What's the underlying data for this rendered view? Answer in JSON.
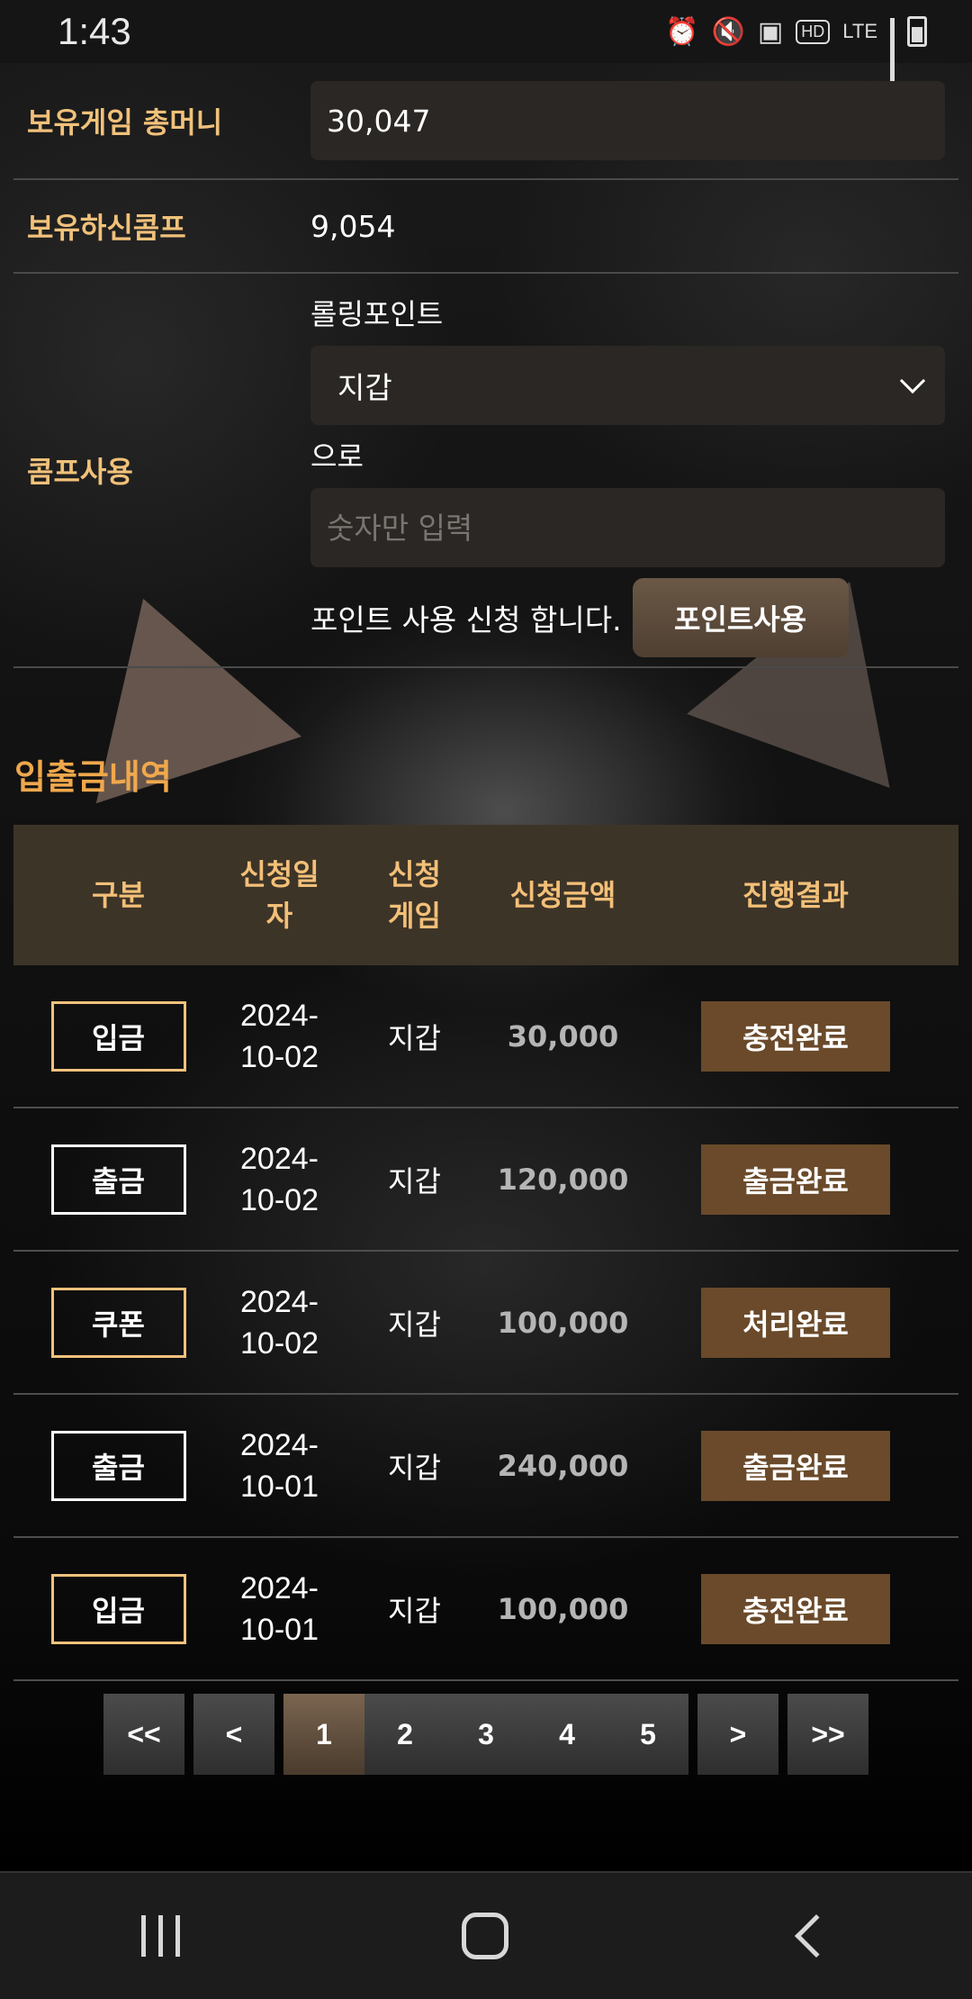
{
  "status_bar": {
    "time": "1:43",
    "icons": [
      "alarm-icon",
      "mute-vibrate-icon",
      "battery-saver-icon",
      "hd-icon",
      "lte-icon",
      "signal-icon",
      "battery-charging-icon"
    ],
    "hd_text": "HD",
    "lte_text": "LTE"
  },
  "balance": {
    "label": "보유게임 총머니",
    "value": "30,047"
  },
  "comp": {
    "label": "보유하신콤프",
    "value": "9,054"
  },
  "comp_use": {
    "label": "콤프사용",
    "rolling_label": "롤링포인트",
    "wallet_selected": "지갑",
    "suffix_label": "으로",
    "amount_placeholder": "숫자만 입력",
    "apply_text": "포인트 사용 신청 합니다.",
    "button_label": "포인트사용"
  },
  "history": {
    "title": "입출금내역",
    "headers": {
      "type": "구분",
      "date": "신청일자",
      "game": "신청게임",
      "amount": "신청금액",
      "result": "진행결과"
    },
    "rows": [
      {
        "type": "입금",
        "date_y": "2024-",
        "date_md": "10-02",
        "game": "지갑",
        "amount": "30,000",
        "result": "충전완료"
      },
      {
        "type": "출금",
        "date_y": "2024-",
        "date_md": "10-02",
        "game": "지갑",
        "amount": "120,000",
        "result": "출금완료"
      },
      {
        "type": "쿠폰",
        "date_y": "2024-",
        "date_md": "10-02",
        "game": "지갑",
        "amount": "100,000",
        "result": "처리완료"
      },
      {
        "type": "출금",
        "date_y": "2024-",
        "date_md": "10-01",
        "game": "지갑",
        "amount": "240,000",
        "result": "출금완료"
      },
      {
        "type": "입금",
        "date_y": "2024-",
        "date_md": "10-01",
        "game": "지갑",
        "amount": "100,000",
        "result": "충전완료"
      }
    ]
  },
  "pagination": {
    "first": "<<",
    "prev": "<",
    "pages": [
      "1",
      "2",
      "3",
      "4",
      "5"
    ],
    "current": "1",
    "next": ">",
    "last": ">>"
  },
  "colors": {
    "accent_gold": "#f1c17a",
    "title_orange": "#f0a84c",
    "header_bg": "#3d3428",
    "result_bg": "#6a4a2a"
  }
}
